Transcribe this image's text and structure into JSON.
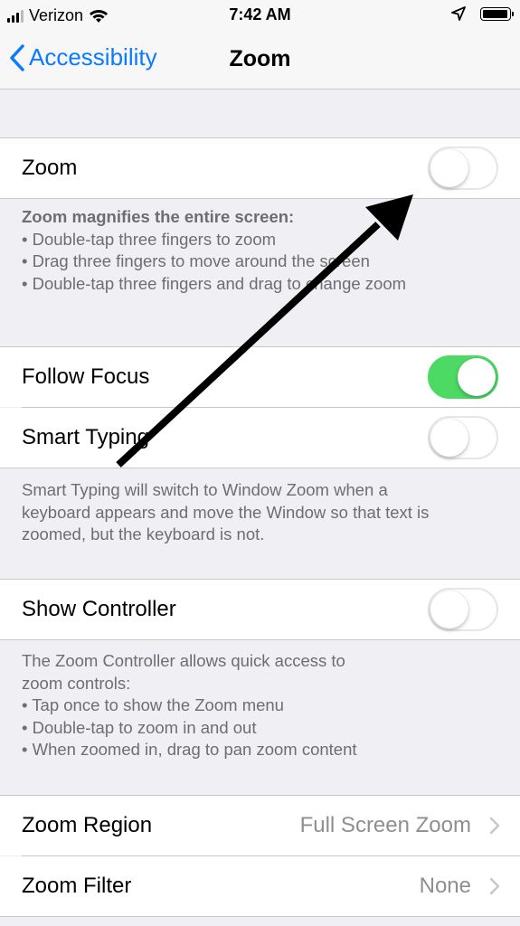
{
  "status_bar": {
    "carrier": "Verizon",
    "time": "7:42 AM",
    "icons": [
      "signal-bars-icon",
      "wifi-icon",
      "location-arrow-icon",
      "battery-icon"
    ]
  },
  "nav": {
    "back_label": "Accessibility",
    "title": "Zoom"
  },
  "zoom_section": {
    "zoom_label": "Zoom",
    "zoom_on": false,
    "footer": [
      "Zoom magnifies the entire screen:",
      "• Double-tap three fingers to zoom",
      "• Drag three fingers to move around the screen",
      "• Double-tap three fingers and drag to change zoom"
    ]
  },
  "focus_section": {
    "follow_focus_label": "Follow Focus",
    "follow_focus_on": true,
    "smart_typing_label": "Smart Typing",
    "smart_typing_on": false,
    "footer": [
      "Smart Typing will switch to Window Zoom when a",
      "keyboard appears and move the Window so that text is",
      "zoomed, but the keyboard is not."
    ]
  },
  "controller_section": {
    "show_controller_label": "Show Controller",
    "show_controller_on": false,
    "footer": [
      "The Zoom Controller allows quick access to",
      "zoom controls:",
      "• Tap once to show the Zoom menu",
      "• Double-tap to zoom in and out",
      "• When zoomed in, drag to pan zoom content"
    ]
  },
  "region_section": {
    "zoom_region_label": "Zoom Region",
    "zoom_region_value": "Full Screen Zoom",
    "zoom_filter_label": "Zoom Filter",
    "zoom_filter_value": "None"
  },
  "colors": {
    "accent": "#0a7aff",
    "toggle_on": "#4cd964",
    "group_background": "#efeff4",
    "footer_text": "#6d6d72",
    "secondary_value": "#8e8e93"
  },
  "annotation": {
    "icon": "arrow-annotation-icon"
  }
}
